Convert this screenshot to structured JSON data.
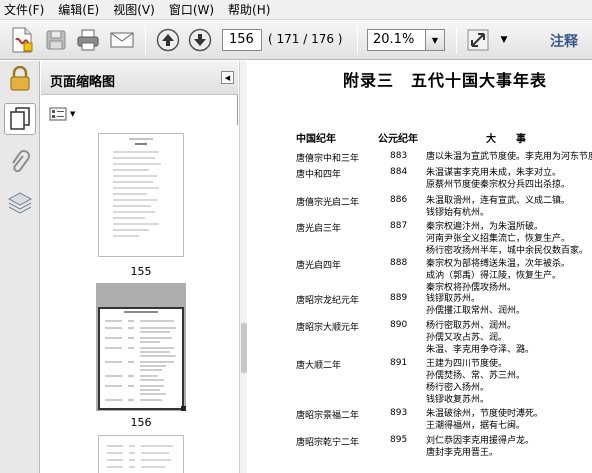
{
  "menu": [
    "文件(F)",
    "编辑(E)",
    "视图(V)",
    "窗口(W)",
    "帮助(H)"
  ],
  "toolbar": {
    "page_current": "156",
    "page_count": "( 171 / 176 )",
    "zoom": "20.1%",
    "annotate_label": "注释"
  },
  "panel": {
    "title": "页面缩略图",
    "thumbnails": [
      {
        "label": "155",
        "heading": "附录"
      },
      {
        "label": "156",
        "heading": "附录三 五代十国大事年表"
      }
    ]
  },
  "document": {
    "title": "附录三　五代十国大事年表",
    "columns": [
      "中国纪年",
      "公元纪年",
      "大　　事"
    ],
    "rows": [
      {
        "era": "唐僖宗中和三年",
        "year": "883",
        "events": [
          "唐以朱温为宣武节度使。李克用为河东节度使。"
        ]
      },
      {
        "era": "唐中和四年",
        "year": "884",
        "events": [
          "朱温谋害李克用未成，朱李对立。",
          "原蔡州节度使秦宗权分兵四出杀掠。"
        ]
      },
      {
        "era": "唐僖宗光启二年",
        "year": "886",
        "events": [
          "朱温取滑州，连有宣武、义成二镇。",
          "钱镠始有杭州。"
        ]
      },
      {
        "era": "唐光启三年",
        "year": "887",
        "events": [
          "秦宗权遍汴州，为朱温所破。",
          "河南尹张全义招集流亡，恢复生产。",
          "杨行密攻扬州半年，城中余民仅数百家。"
        ]
      },
      {
        "era": "唐光启四年",
        "year": "888",
        "events": [
          "秦宗权为部将缚送朱温，次年被杀。",
          "成汭（郭禹）得江陵，恢复生产。",
          "秦宗权将孙儒攻扬州。"
        ]
      },
      {
        "era": "唐昭宗龙纪元年",
        "year": "889",
        "events": [
          "钱镠取苏州。",
          "孙儒攫江取常州、润州。"
        ]
      },
      {
        "era": "唐昭宗大顺元年",
        "year": "890",
        "events": [
          "杨行密取苏州、润州。",
          "孙儒又攻占苏、润。",
          "朱温、李克用争夺泽、潞。"
        ]
      },
      {
        "era": "唐大顺二年",
        "year": "891",
        "events": [
          "王建为四川节度使。",
          "孙儒焚扬、常、苏三州。",
          "杨行密入扬州。",
          "钱镠收复苏州。"
        ]
      },
      {
        "era": "唐昭宗景福二年",
        "year": "893",
        "events": [
          "朱温破徐州，节度使时溥死。",
          "王潮得福州，据有七闽。"
        ]
      },
      {
        "era": "唐昭宗乾宁二年",
        "year": "895",
        "events": [
          "刘仁恭因李克用援得卢龙。",
          "唐封李克用晋王。"
        ]
      }
    ]
  },
  "colors": {
    "annotate": "#3a5a8c",
    "toolbar_top": "#f7f7f7",
    "toolbar_bottom": "#e2e2e2",
    "panel_bg": "#e8e8e8"
  }
}
